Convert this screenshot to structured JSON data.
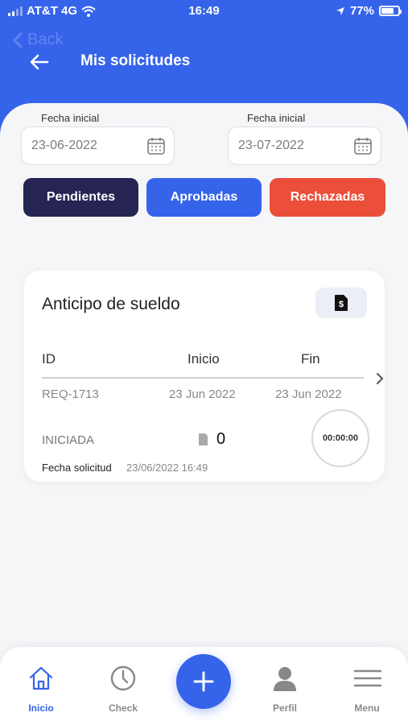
{
  "status_bar": {
    "carrier": "AT&T 4G",
    "time": "16:49",
    "battery": "77%",
    "battery_level": 0.77
  },
  "header": {
    "back_ghost_label": "Back",
    "title": "Mis solicitudes"
  },
  "filters": {
    "start_date": {
      "label": "Fecha inicial",
      "value": "23-06-2022"
    },
    "end_date": {
      "label": "Fecha inicial",
      "value": "23-07-2022"
    },
    "buttons": [
      {
        "label": "Pendientes",
        "color": "#252452"
      },
      {
        "label": "Aprobadas",
        "color": "#3563ea"
      },
      {
        "label": "Rechazadas",
        "color": "#eb4f3a"
      }
    ]
  },
  "request_card": {
    "title": "Anticipo de sueldo",
    "columns": [
      "ID",
      "Inicio",
      "Fin"
    ],
    "row": {
      "id": "REQ-1713",
      "start": "23 Jun 2022",
      "end": "23 Jun 2022"
    },
    "status": "INICIADA",
    "count": "0",
    "timer": "00:00:00",
    "request_date_label": "Fecha solicitud",
    "request_date": "23/06/2022 16:49"
  },
  "bottom_nav": {
    "items": [
      {
        "label": "Inicio",
        "icon": "home-icon",
        "active": true
      },
      {
        "label": "Check",
        "icon": "clock-icon"
      },
      {
        "label": "Perfil",
        "icon": "user-icon"
      },
      {
        "label": "Menu",
        "icon": "menu-icon"
      }
    ],
    "fab_icon": "plus-icon"
  },
  "colors": {
    "primary": "#3563ea",
    "dark": "#252452",
    "danger": "#eb4f3a"
  }
}
